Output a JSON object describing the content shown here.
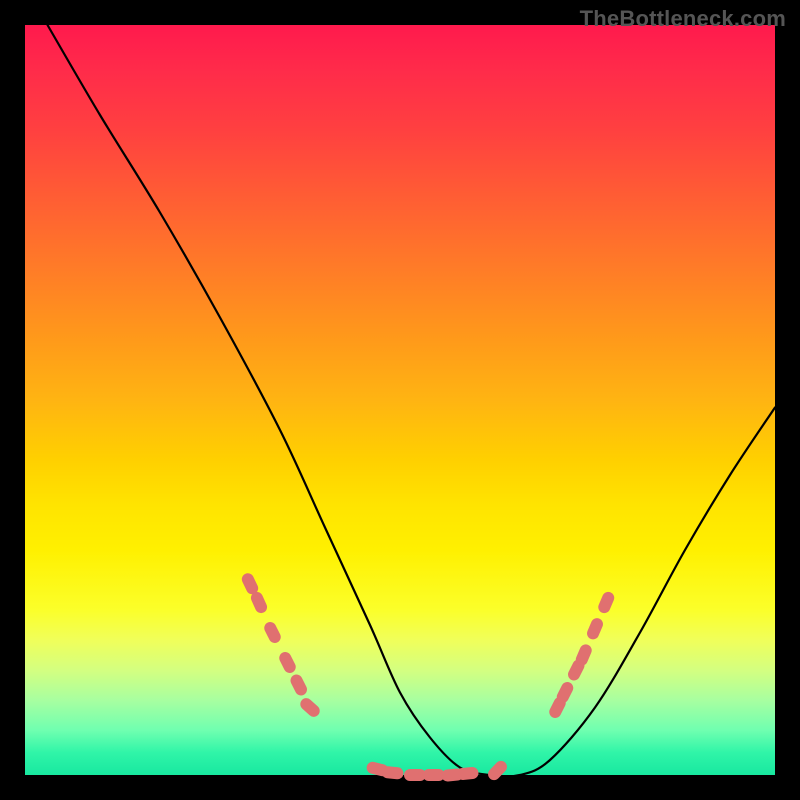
{
  "watermark": "TheBottleneck.com",
  "chart_data": {
    "type": "line",
    "title": "",
    "xlabel": "",
    "ylabel": "",
    "xlim": [
      0,
      100
    ],
    "ylim": [
      0,
      100
    ],
    "curve": {
      "name": "bottleneck-curve",
      "x": [
        3,
        10,
        18,
        26,
        34,
        40,
        46,
        50,
        54,
        58,
        62,
        66,
        70,
        76,
        82,
        88,
        94,
        100
      ],
      "y": [
        100,
        88,
        75,
        61,
        46,
        33,
        20,
        11,
        5,
        1,
        0,
        0,
        2,
        9,
        19,
        30,
        40,
        49
      ]
    },
    "markers": {
      "name": "sample-points",
      "color": "#e07070",
      "points": [
        {
          "x": 30,
          "y": 25.5
        },
        {
          "x": 31.2,
          "y": 23
        },
        {
          "x": 33,
          "y": 19
        },
        {
          "x": 35,
          "y": 15
        },
        {
          "x": 36.5,
          "y": 12
        },
        {
          "x": 38,
          "y": 9
        },
        {
          "x": 47,
          "y": 0.8
        },
        {
          "x": 49,
          "y": 0.3
        },
        {
          "x": 52,
          "y": 0
        },
        {
          "x": 54.5,
          "y": 0
        },
        {
          "x": 57,
          "y": 0
        },
        {
          "x": 59,
          "y": 0.2
        },
        {
          "x": 63,
          "y": 0.6
        },
        {
          "x": 71,
          "y": 9
        },
        {
          "x": 72,
          "y": 11
        },
        {
          "x": 73.5,
          "y": 14
        },
        {
          "x": 74.5,
          "y": 16
        },
        {
          "x": 76,
          "y": 19.5
        },
        {
          "x": 77.5,
          "y": 23
        }
      ]
    },
    "background_gradient": {
      "top": "#ff1a4d",
      "mid": "#ffd000",
      "bottom": "#18e8a0"
    }
  }
}
